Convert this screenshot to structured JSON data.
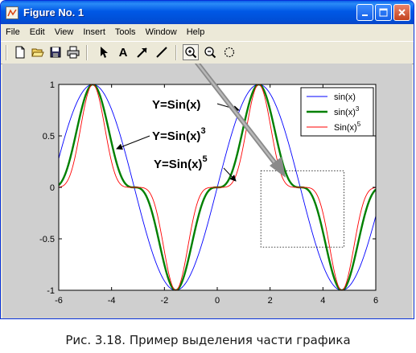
{
  "window": {
    "title": "Figure No. 1",
    "controls": [
      "minimize-icon",
      "maximize-icon",
      "close-icon"
    ]
  },
  "menu": [
    "File",
    "Edit",
    "View",
    "Insert",
    "Tools",
    "Window",
    "Help"
  ],
  "toolbar": {
    "tools": [
      "new-file-icon",
      "open-folder-icon",
      "save-icon",
      "print-icon",
      "arrow-select-icon",
      "text-A-icon",
      "arrow-draw-icon",
      "line-draw-icon",
      "zoom-in-icon",
      "zoom-out-icon",
      "rotate-3d-icon"
    ],
    "text_tool_label": "A",
    "pressed_tool": "zoom-in-icon"
  },
  "annotations": {
    "a1": "Y=Sin(x)",
    "a2_base": "Y=Sin(x)",
    "a2_exp": "3",
    "a3_base": "Y=Sin(x)",
    "a3_exp": "5"
  },
  "chart_data": {
    "type": "line",
    "xlim": [
      -6,
      6
    ],
    "ylim": [
      -1,
      1
    ],
    "xticks": [
      -6,
      -4,
      -2,
      0,
      2,
      4,
      6
    ],
    "xtick_labels": [
      "-6",
      "-4",
      "-2",
      "0",
      "2",
      "4",
      "6"
    ],
    "yticks": [
      -1,
      -0.5,
      0,
      0.5,
      1
    ],
    "ytick_labels": [
      "-1",
      "-0.5",
      "0",
      "0.5",
      "1"
    ],
    "series": [
      {
        "name": "sin(x)",
        "exponent": 1,
        "color": "#0000ff"
      },
      {
        "name": "sin(x)",
        "legend_exp": "3",
        "exponent": 3,
        "color": "#008000"
      },
      {
        "name": "Sin(x)",
        "legend_exp": "5",
        "exponent": 5,
        "color": "#ff0000"
      }
    ],
    "legend_position": "top-right",
    "grid": false,
    "zoom_rect_x": [
      1.65,
      4.8
    ],
    "zoom_rect_y": [
      -0.58,
      0.16
    ]
  },
  "caption": {
    "prefix": "Рис. 3.18.",
    "text": " Пример выделения части графика"
  }
}
